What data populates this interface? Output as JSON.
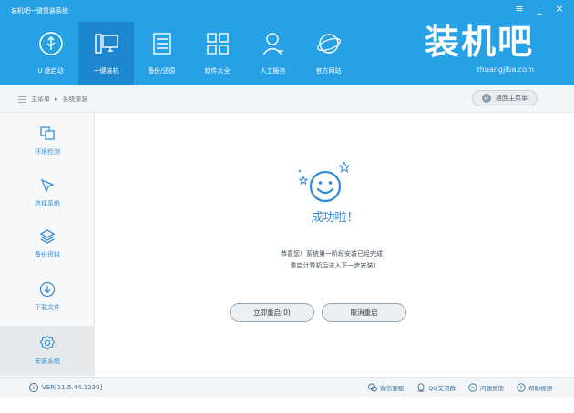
{
  "window": {
    "title": "装机吧一键重装系统",
    "controls": [
      "≡",
      "_",
      "×"
    ]
  },
  "nav": {
    "items": [
      {
        "label": "U 盘启动",
        "icon": "usb-icon"
      },
      {
        "label": "一键装机",
        "icon": "computer-icon",
        "active": true
      },
      {
        "label": "备份/还原",
        "icon": "backup-restore-icon"
      },
      {
        "label": "软件大全",
        "icon": "software-grid-icon"
      },
      {
        "label": "人工服务",
        "icon": "support-person-icon"
      },
      {
        "label": "官方网站",
        "icon": "website-globe-icon"
      }
    ]
  },
  "brand": {
    "logo": "装机吧",
    "url": "zhuangjiba.com"
  },
  "breadcrumb": {
    "root": "主菜单",
    "separator": "▸",
    "current": "系统重装"
  },
  "back_button": {
    "label": "返回主菜单"
  },
  "sidebar": {
    "steps": [
      {
        "label": "环境检测",
        "icon": "environment-check-icon"
      },
      {
        "label": "选择系统",
        "icon": "cursor-select-icon"
      },
      {
        "label": "备份资料",
        "icon": "layers-backup-icon"
      },
      {
        "label": "下载文件",
        "icon": "download-icon"
      },
      {
        "label": "安装系统",
        "icon": "gear-install-icon",
        "active": true
      }
    ]
  },
  "main": {
    "title": "成功啦！",
    "message_line1": "恭喜您！系统第一阶段安装已经完成！",
    "message_line2": "重启计算机后进入下一步安装！",
    "restart_button": "立即重启(0)",
    "cancel_button": "取消重启"
  },
  "footer": {
    "version": "VER[11.5.44.1230]",
    "links": [
      {
        "label": "微信客服",
        "icon": "wechat-icon"
      },
      {
        "label": "QQ交流群",
        "icon": "qq-icon"
      },
      {
        "label": "问题反馈",
        "icon": "feedback-icon"
      },
      {
        "label": "帮助视频",
        "icon": "help-icon"
      }
    ]
  },
  "colors": {
    "header_blue": "#27a1e6",
    "active_nav": "#1d88cf",
    "accent_text": "#3189d9"
  }
}
